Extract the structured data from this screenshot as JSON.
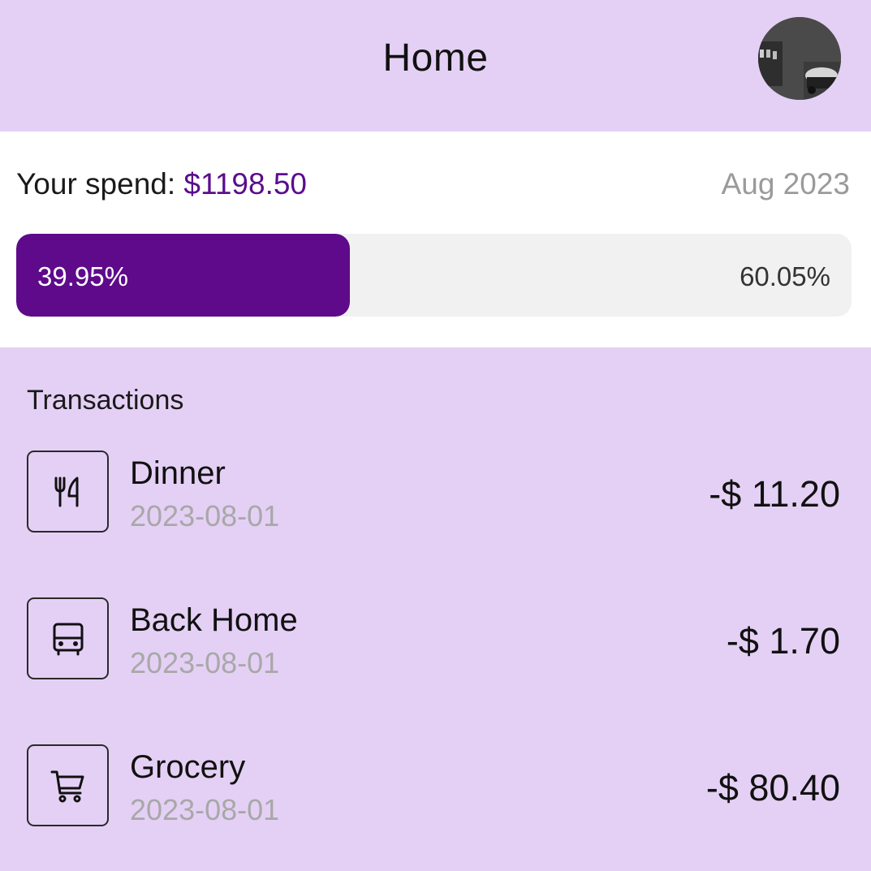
{
  "header": {
    "title": "Home",
    "avatar": "user-avatar-photo"
  },
  "spend": {
    "label": "Your spend: ",
    "amount": "$1198.50",
    "month": "Aug 2023",
    "progress_fraction": 0.3995,
    "used_pct": "39.95%",
    "remaining_pct": "60.05%",
    "accent": "#5e0a8a"
  },
  "transactions": {
    "title": "Transactions",
    "items": [
      {
        "name": "Dinner",
        "date": "2023-08-01",
        "amount": "-$ 11.20",
        "icon": "fork-knife-icon"
      },
      {
        "name": "Back Home",
        "date": "2023-08-01",
        "amount": "-$ 1.70",
        "icon": "bus-icon"
      },
      {
        "name": "Grocery",
        "date": "2023-08-01",
        "amount": "-$ 80.40",
        "icon": "cart-icon"
      }
    ]
  },
  "colors": {
    "background": "#e4d0f5",
    "card": "#ffffff",
    "accent": "#5e0a8a",
    "muted": "#a8a8a8"
  }
}
